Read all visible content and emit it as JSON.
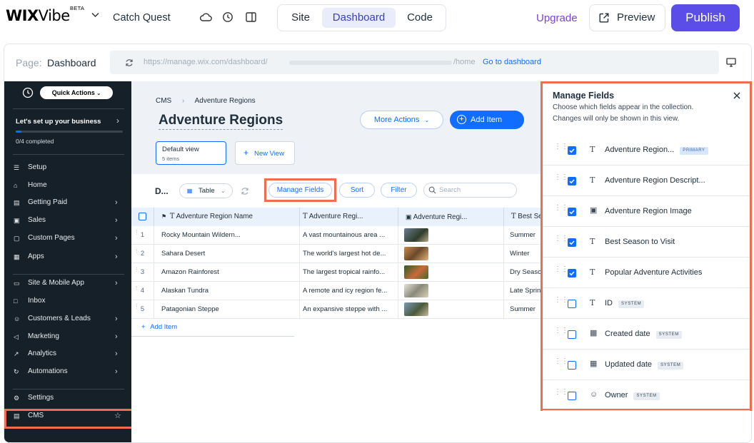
{
  "topbar": {
    "logo_wix": "WIX",
    "logo_vibe": "Vibe",
    "beta": "BETA",
    "site_name": "Catch Quest",
    "tabs": [
      "Site",
      "Dashboard",
      "Code"
    ],
    "active_tab": "Dashboard",
    "upgrade": "Upgrade",
    "preview": "Preview",
    "publish": "Publish"
  },
  "pagebar": {
    "page_label": "Page:",
    "page_name": "Dashboard",
    "url_prefix": "https://manage.wix.com/dashboard/",
    "url_suffix": "/home",
    "go_link": "Go to dashboard"
  },
  "sidebar": {
    "quick_actions": "Quick Actions",
    "setup_title": "Let's set up your business",
    "progress_text": "0/4 completed",
    "progress_fraction": 0.05,
    "items": [
      {
        "label": "Setup",
        "icon": "checklist-icon",
        "chevron": false
      },
      {
        "label": "Home",
        "icon": "home-icon",
        "chevron": false
      },
      {
        "label": "Getting Paid",
        "icon": "payment-icon",
        "chevron": true
      },
      {
        "label": "Sales",
        "icon": "sales-icon",
        "chevron": true
      },
      {
        "label": "Custom Pages",
        "icon": "pages-icon",
        "chevron": true
      },
      {
        "label": "Apps",
        "icon": "apps-icon",
        "chevron": true
      },
      {
        "label": "Site & Mobile App",
        "icon": "site-icon",
        "chevron": true
      },
      {
        "label": "Inbox",
        "icon": "inbox-icon",
        "chevron": false
      },
      {
        "label": "Customers & Leads",
        "icon": "customers-icon",
        "chevron": true
      },
      {
        "label": "Marketing",
        "icon": "marketing-icon",
        "chevron": true
      },
      {
        "label": "Analytics",
        "icon": "analytics-icon",
        "chevron": true
      },
      {
        "label": "Automations",
        "icon": "automations-icon",
        "chevron": true
      },
      {
        "label": "Settings",
        "icon": "settings-icon",
        "chevron": false
      },
      {
        "label": "CMS",
        "icon": "cms-icon",
        "chevron": false
      }
    ]
  },
  "main": {
    "breadcrumb_root": "CMS",
    "breadcrumb_current": "Adventure Regions",
    "title": "Adventure Regions",
    "more_actions": "More Actions",
    "add_item": "Add Item",
    "view_name": "Default view",
    "view_count": "5 items",
    "new_view": "New View",
    "toolbar_title": "D...",
    "layout_select": "Table",
    "manage_fields": "Manage Fields",
    "sort": "Sort",
    "filter": "Filter",
    "search_placeholder": "Search",
    "add_item_row": "Add Item"
  },
  "table": {
    "columns": [
      "Adventure Region Name",
      "Adventure Regi...",
      "Adventure Regi...",
      "Best Sea..."
    ],
    "rows": [
      {
        "num": "1",
        "name": "Rocky Mountain Wildern...",
        "desc": "A vast mountainous area ...",
        "season": "Summer"
      },
      {
        "num": "2",
        "name": "Sahara Desert",
        "desc": "The world's largest hot de...",
        "season": "Winter"
      },
      {
        "num": "3",
        "name": "Amazon Rainforest",
        "desc": "The largest tropical rainfo...",
        "season": "Dry Seaso"
      },
      {
        "num": "4",
        "name": "Alaskan Tundra",
        "desc": "A remote and icy region fe...",
        "season": "Late Sprin"
      },
      {
        "num": "5",
        "name": "Patagonian Steppe",
        "desc": "An expansive steppe with ...",
        "season": "Summer"
      }
    ]
  },
  "panel": {
    "title": "Manage Fields",
    "description_1": "Choose which fields appear in the collection.",
    "description_2": "Changes will only be shown in this view.",
    "fields": [
      {
        "label": "Adventure Region...",
        "tag": "PRIMARY",
        "checked": true,
        "icon": "text-type-icon"
      },
      {
        "label": "Adventure Region Descript...",
        "tag": "",
        "checked": true,
        "icon": "text-type-icon"
      },
      {
        "label": "Adventure Region Image",
        "tag": "",
        "checked": true,
        "icon": "image-type-icon"
      },
      {
        "label": "Best Season to Visit",
        "tag": "",
        "checked": true,
        "icon": "text-type-icon"
      },
      {
        "label": "Popular Adventure Activities",
        "tag": "",
        "checked": true,
        "icon": "text-type-icon"
      },
      {
        "label": "ID",
        "tag": "SYSTEM",
        "checked": false,
        "icon": "text-type-icon"
      },
      {
        "label": "Created date",
        "tag": "SYSTEM",
        "checked": false,
        "icon": "calendar-icon"
      },
      {
        "label": "Updated date",
        "tag": "SYSTEM",
        "checked": false,
        "icon": "calendar-edit-icon"
      },
      {
        "label": "Owner",
        "tag": "SYSTEM",
        "checked": false,
        "icon": "person-icon"
      }
    ]
  },
  "colors": {
    "accent": "#116dff",
    "publish": "#5b4ee8",
    "highlight": "#f26c4f",
    "sidebar": "#162028",
    "upgrade": "#7b3fe4"
  }
}
